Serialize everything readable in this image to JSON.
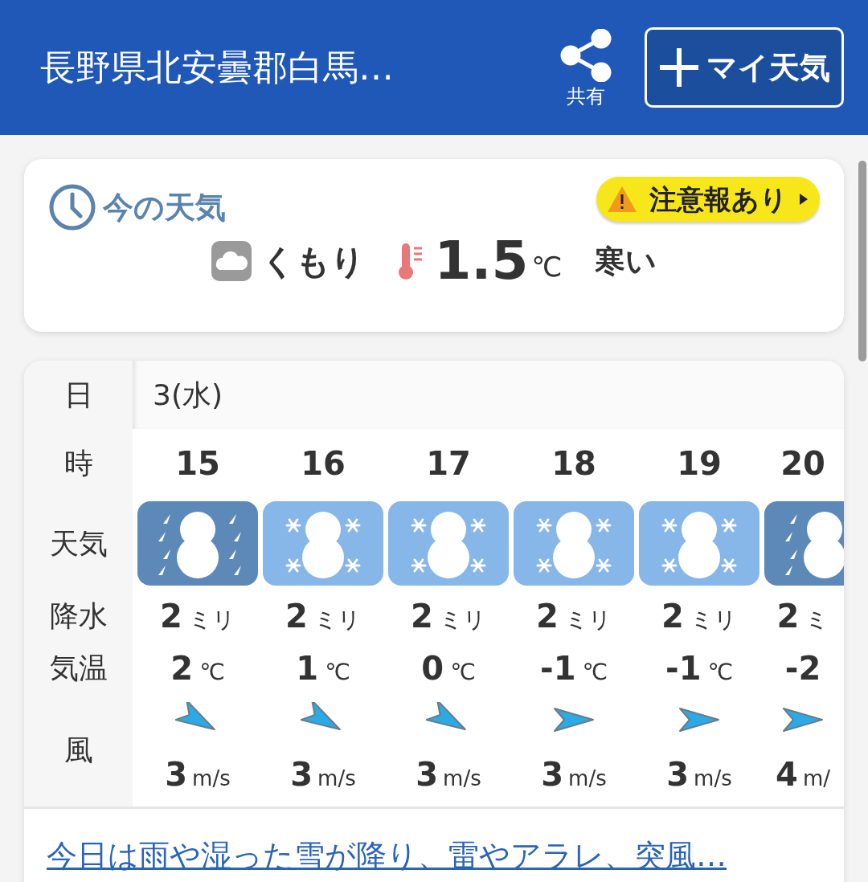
{
  "header": {
    "title": "長野県北安曇郡白馬…",
    "share_label": "共有",
    "my_weather_button": "マイ天気"
  },
  "current": {
    "title": "今の天気",
    "alert": "注意報あり",
    "condition": "くもり",
    "temperature": "1.5",
    "unit": "℃",
    "feel": "寒い"
  },
  "forecast": {
    "labels": {
      "date": "日",
      "hour": "時",
      "weather": "天気",
      "precip": "降水",
      "temp": "気温",
      "wind": "風"
    },
    "date": "3(水)",
    "hours": [
      {
        "hour": "15",
        "kind": "sleet",
        "precip": "2",
        "precip_unit": "ミリ",
        "temp": "2",
        "temp_unit": "℃",
        "wind_arrow": {
          "kind": "down_right"
        },
        "wind": "3",
        "wind_unit": "m/s"
      },
      {
        "hour": "16",
        "kind": "snow",
        "precip": "2",
        "precip_unit": "ミリ",
        "temp": "1",
        "temp_unit": "℃",
        "wind_arrow": {
          "kind": "down_right"
        },
        "wind": "3",
        "wind_unit": "m/s"
      },
      {
        "hour": "17",
        "kind": "snow",
        "precip": "2",
        "precip_unit": "ミリ",
        "temp": "0",
        "temp_unit": "℃",
        "wind_arrow": {
          "kind": "down_right"
        },
        "wind": "3",
        "wind_unit": "m/s"
      },
      {
        "hour": "18",
        "kind": "snow",
        "precip": "2",
        "precip_unit": "ミリ",
        "temp": "-1",
        "temp_unit": "℃",
        "wind_arrow": {
          "kind": "right"
        },
        "wind": "3",
        "wind_unit": "m/s"
      },
      {
        "hour": "19",
        "kind": "snow",
        "precip": "2",
        "precip_unit": "ミリ",
        "temp": "-1",
        "temp_unit": "℃",
        "wind_arrow": {
          "kind": "right"
        },
        "wind": "3",
        "wind_unit": "m/s"
      },
      {
        "hour": "20",
        "kind": "sleet",
        "precip": "2",
        "precip_unit": "ミ",
        "temp": "-2",
        "wind_arrow": {
          "kind": "right"
        },
        "wind": "4",
        "wind_unit": "m/"
      }
    ]
  },
  "summary_link": "今日は雨や湿った雪が降り、雷やアラレ、突風…"
}
